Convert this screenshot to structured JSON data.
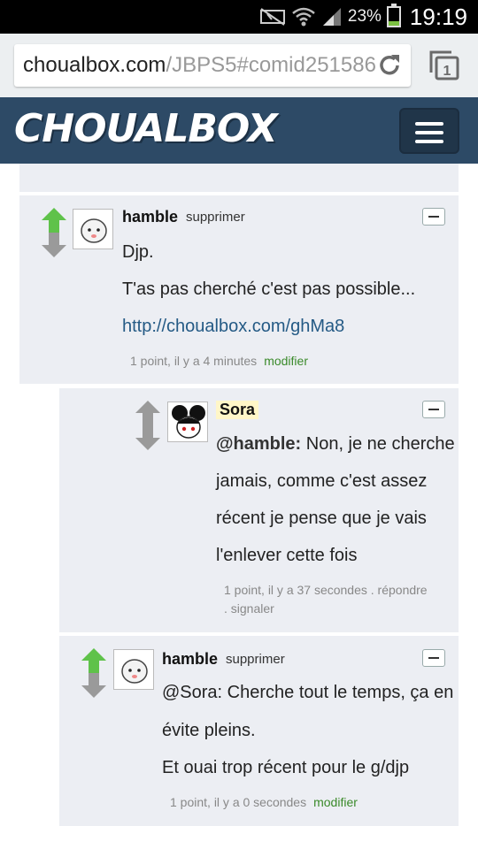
{
  "status_bar": {
    "battery_percent": "23%",
    "battery_level": 0.23,
    "time": "19:19",
    "icons": [
      "mute-icon",
      "wifi-icon",
      "signal-icon",
      "battery-icon"
    ]
  },
  "browser": {
    "url_host": "choualbox.com",
    "url_path": "/JBPS5#comid251586",
    "reload_icon": "reload-icon",
    "tabs_icon": "tabs-icon",
    "tabs_count": "1"
  },
  "navbar": {
    "logo_text": "CHOUALBOX",
    "menu_icon": "hamburger-menu-icon",
    "bg_color": "#2d4a66"
  },
  "comments": [
    {
      "author": "hamble",
      "action": "supprimer",
      "lines": [
        "Djp.",
        "T'as pas cherché c'est pas possible...",
        "http://choualbox.com/ghMa8"
      ],
      "meta": "1 point, il y a 4 minutes",
      "edit": "modifier"
    },
    {
      "author": "Sora",
      "mention": "@hamble:",
      "lines": [
        "Non, je ne cherche",
        "jamais, comme c'est assez",
        "récent je pense que je vais",
        "l'enlever cette fois"
      ],
      "meta_line1": "1 point, il y a 37 secondes . répondre",
      "meta_line2": ". signaler"
    },
    {
      "author": "hamble",
      "action": "supprimer",
      "lines": [
        "@Sora: Cherche tout le temps, ça en",
        "évite pleins.",
        "Et ouai trop récent pour le g/djp"
      ],
      "meta": "1 point, il y a 0 secondes",
      "edit": "modifier"
    }
  ],
  "colors": {
    "upvote": "#5fc24a",
    "downvote": "#9a9a9a",
    "comment_bg": "#eceef3",
    "link": "#245a85",
    "edit_link": "#3a8a2a"
  }
}
